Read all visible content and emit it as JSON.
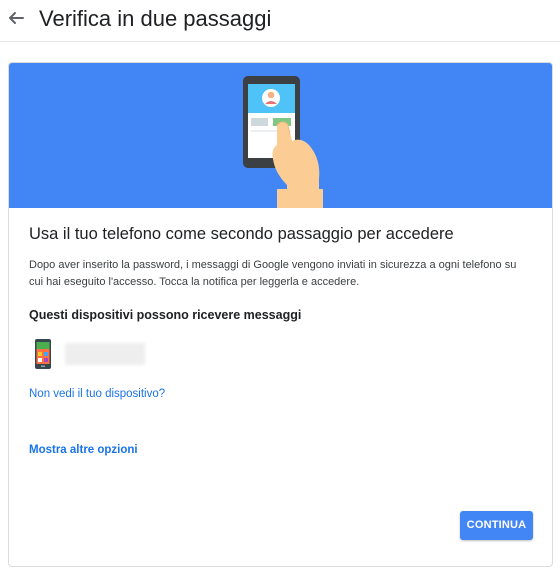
{
  "header": {
    "back_icon": "arrow-back-icon",
    "title": "Verifica in due passaggi"
  },
  "card": {
    "hero_illustration": "phone-tap-illustration",
    "hero_color": "#4285f4",
    "heading": "Usa il tuo telefono come secondo passaggio per accedere",
    "description": "Dopo aver inserito la password, i messaggi di Google vengono inviati in sicurezza a ogni telefono su cui hai eseguito l'accesso. Tocca la notifica per leggerla e accedere.",
    "devices_title": "Questi dispositivi possono ricevere messaggi",
    "devices": [
      {
        "icon": "android-phone-icon",
        "name": ""
      }
    ],
    "missing_device_link": "Non vedi il tuo dispositivo?",
    "more_options_link": "Mostra altre opzioni",
    "continue_label": "CONTINUA"
  },
  "colors": {
    "accent": "#4285f4",
    "link": "#1a73e8",
    "text": "#202124"
  }
}
